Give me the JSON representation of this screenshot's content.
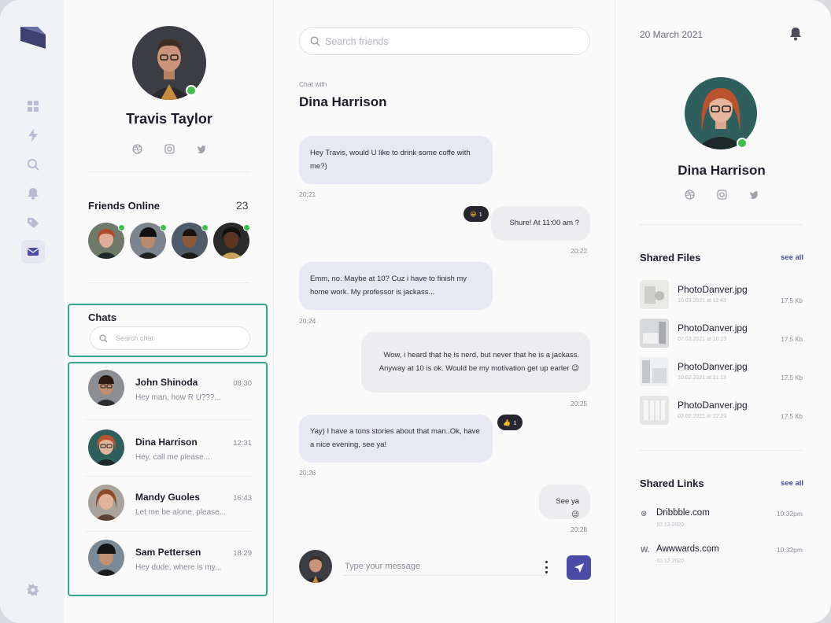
{
  "sidebar": {
    "icons": [
      "logo-icon",
      "grid-icon",
      "bolt-icon",
      "search-icon",
      "bell-icon",
      "tag-icon",
      "mail-icon",
      "settings-icon"
    ],
    "active": "mail-icon"
  },
  "profile": {
    "name": "Travis Taylor",
    "socials": [
      "dribbble-icon",
      "instagram-icon",
      "twitter-icon"
    ],
    "online": true
  },
  "friends_online": {
    "title": "Friends Online",
    "count": "23"
  },
  "chats": {
    "title": "Chats",
    "search_placeholder": "Search chat",
    "items": [
      {
        "name": "John Shinoda",
        "preview": "Hey man, how R U???...",
        "time": "08:30"
      },
      {
        "name": "Dina Harrison",
        "preview": "Hey, call me please...",
        "time": "12:31"
      },
      {
        "name": "Mandy Guoles",
        "preview": "Let me be alone, please...",
        "time": "16:43"
      },
      {
        "name": "Sam Pettersen",
        "preview": "Hey dude, where is my...",
        "time": "18:29"
      }
    ]
  },
  "conversation": {
    "search_placeholder": "Search friends",
    "chat_with_label": "Chat with",
    "contact": "Dina Harrison",
    "messages": [
      {
        "dir": "in",
        "lines": [
          "Hey Travis, would U like to drink some coffe with",
          "me?)"
        ],
        "time": "20:21"
      },
      {
        "dir": "out",
        "lines": [
          "Shure! At 11:00 am ?"
        ],
        "time": "20:22",
        "reaction": {
          "emoji": "😀",
          "count": "1"
        }
      },
      {
        "dir": "in",
        "lines": [
          "Emm, no. Maybe at 10? Cuz i have to finish my",
          "home work. My professor is jackass..."
        ],
        "time": "20:24"
      },
      {
        "dir": "out",
        "lines": [
          "Wow, i heard that he is nerd, but never that he is a jackass.",
          "Anyway at 10 is ok. Would be my motivation get up earler 😉"
        ],
        "time": "20:25"
      },
      {
        "dir": "in",
        "lines": [
          "Yay) I have a tons stories about that man..Ok, have",
          "a nice evening, see ya!"
        ],
        "time": "20:26",
        "reaction": {
          "emoji": "👍",
          "count": "1"
        }
      },
      {
        "dir": "out",
        "lines": [
          "See ya😉"
        ],
        "time": "20:28"
      }
    ],
    "composer_placeholder": "Type your message"
  },
  "details": {
    "date": "20 March 2021",
    "name": "Dina Harrison",
    "shared_files": {
      "title": "Shared Files",
      "see_all": "see all",
      "items": [
        {
          "name": "PhotoDanver.jpg",
          "date": "10.03.2021 at 11:43",
          "size": "17.5 Kb"
        },
        {
          "name": "PhotoDanver.jpg",
          "date": "07.03.2021 at 10:23",
          "size": "17.5 Kb"
        },
        {
          "name": "PhotoDanver.jpg",
          "date": "10.02.2021 at 11:13",
          "size": "17.5 Kb"
        },
        {
          "name": "PhotoDanver.jpg",
          "date": "02.02.2021 at 22:23",
          "size": "17.5 Kb"
        }
      ]
    },
    "shared_links": {
      "title": "Shared Links",
      "see_all": "see all",
      "items": [
        {
          "icon": "⊛",
          "name": "Dribbble.com",
          "date": "10.12.2020",
          "time": "10:32pm"
        },
        {
          "icon": "W.",
          "name": "Awwwards.com",
          "date": "10.12.2020",
          "time": "10:32pm"
        }
      ]
    }
  },
  "colors": {
    "accent": "#4a4ca8",
    "online": "#3fbf4f",
    "highlight_border": "#33a58a",
    "bubble_in": "#e7e8f3",
    "bubble_out": "#ededf0"
  }
}
